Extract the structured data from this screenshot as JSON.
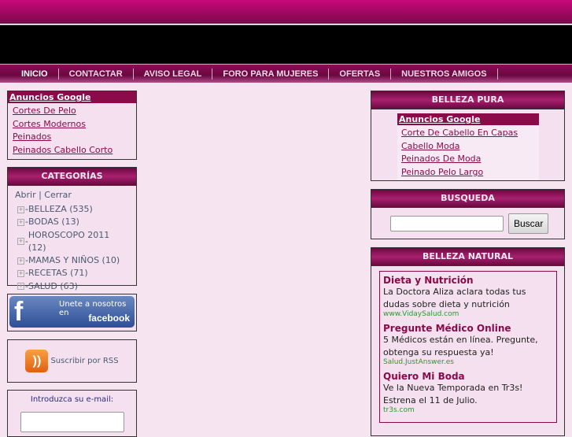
{
  "nav": [
    "INICIO",
    "CONTACTAR",
    "AVISO LEGAL",
    "FORO PARA MUJERES",
    "OFERTAS",
    "NUESTROS AMIGOS"
  ],
  "left_ads": {
    "title": "Anuncios Google",
    "links": [
      "Cortes De Pelo",
      "Cortes Modernos",
      "Peinados",
      "Peinados Cabello Corto"
    ]
  },
  "categories": {
    "title": "CATEGORÍAS",
    "toggle": "Abrir | Cerrar",
    "items": [
      "BELLEZA (535)",
      "BODAS (13)",
      "HOROSCOPO 2011 (12)",
      "MAMAS Y NIÑOS (10)",
      "RECETAS (71)",
      "SALUD (63)"
    ]
  },
  "facebook": {
    "line1": "Unete a nosotros en",
    "line2": "facebook"
  },
  "rss": "Suscribir por RSS",
  "email_label": "Introduzca su e-mail:",
  "belleza_pura": {
    "title": "BELLEZA PURA",
    "ads_title": "Anuncios Google",
    "links": [
      "Corte De Cabello En Capas",
      "Cabello Moda",
      "Peinados De Moda",
      "Peinado Pelo Largo"
    ]
  },
  "busqueda": {
    "title": "BUSQUEDA",
    "button": "Buscar",
    "value": ""
  },
  "belleza_natural": {
    "title": "BELLEZA NATURAL",
    "ads": [
      {
        "title": "Dieta y Nutrición",
        "desc": "La Doctora Aliza aclara todas tus dudas sobre dieta y nutrición",
        "url": "www.VidaySalud.com"
      },
      {
        "title": "Pregunte Médico Online",
        "desc": "5 Médicos están en línea. Pregunte, obtenga su respuesta ya!",
        "url": "Salud.JustAnswer.es"
      },
      {
        "title": "Quiero Mi Boda",
        "desc": "Ve la Nueva Temporada en Tr3s! Estrena el 11 de Julio.",
        "url": "tr3s.com"
      }
    ]
  }
}
